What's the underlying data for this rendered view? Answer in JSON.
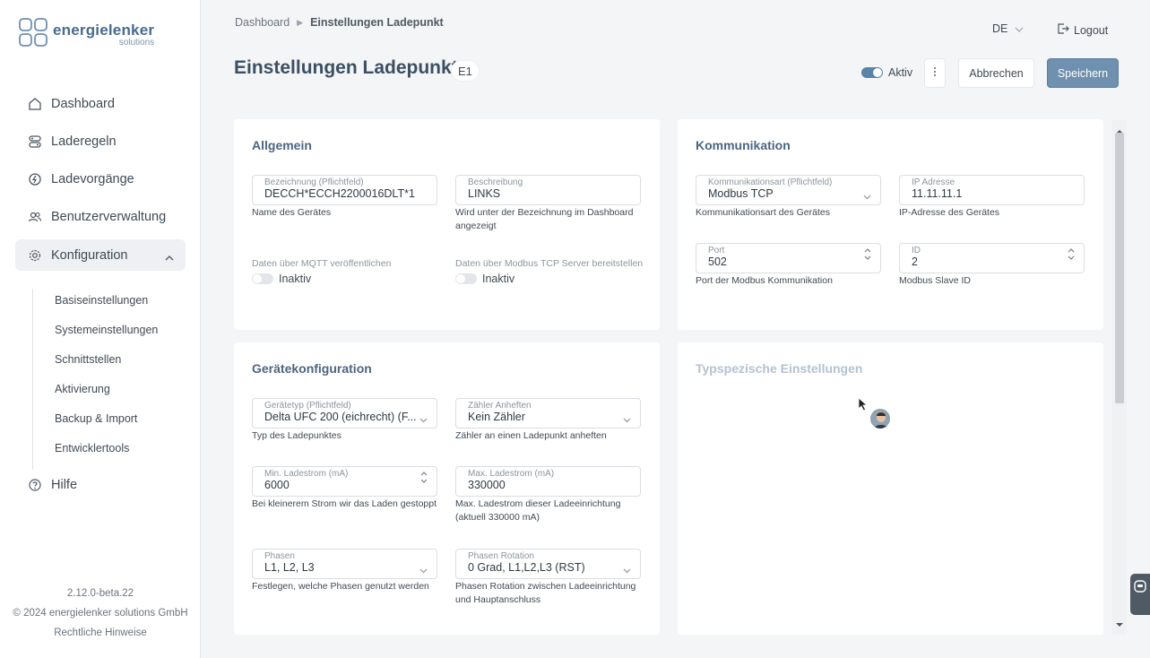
{
  "brand": {
    "name": "energielenker",
    "sub": "solutions"
  },
  "nav": {
    "items": [
      {
        "label": "Dashboard",
        "icon": "home-icon"
      },
      {
        "label": "Laderegeln",
        "icon": "rules-icon"
      },
      {
        "label": "Ladevorgänge",
        "icon": "charging-sessions-icon"
      },
      {
        "label": "Benutzerverwaltung",
        "icon": "users-icon"
      },
      {
        "label": "Konfiguration",
        "icon": "gear-icon"
      },
      {
        "label": "Hilfe",
        "icon": "help-icon"
      }
    ],
    "subitems": [
      "Basiseinstellungen",
      "Systemeinstellungen",
      "Schnittstellen",
      "Aktivierung",
      "Backup & Import",
      "Entwicklertools"
    ]
  },
  "footer": {
    "version": "2.12.0-beta.22",
    "copyright": "© 2024 energielenker solutions GmbH",
    "legal": "Rechtliche Hinweise"
  },
  "header": {
    "breadcrumb": [
      "Dashboard",
      "Einstellungen Ladepunkt"
    ],
    "language": "DE",
    "logout": "Logout",
    "title": "Einstellungen Ladepunkt",
    "badge": "E1",
    "active_label": "Aktiv",
    "cancel": "Abbrechen",
    "save": "Speichern"
  },
  "allgemein": {
    "title": "Allgemein",
    "name_label": "Bezeichnung (Pflichtfeld)",
    "name_value": "DECCH*ECCH2200016DLT*1",
    "name_hint": "Name des Gerätes",
    "desc_label": "Beschreibung",
    "desc_value": "LINKS",
    "desc_hint": "Wird unter der Bezeichnung im Dashboard angezeigt",
    "mqtt_label": "Daten über MQTT veröffentlichen",
    "mqtt_state": "Inaktiv",
    "modbus_label": "Daten über Modbus TCP Server bereitstellen",
    "modbus_state": "Inaktiv"
  },
  "kommunikation": {
    "title": "Kommunikation",
    "type_label": "Kommunikationsart (Pflichtfeld)",
    "type_value": "Modbus TCP",
    "type_hint": "Kommunikationsart des Gerätes",
    "ip_label": "IP Adresse",
    "ip_value": "11.11.11.1",
    "ip_hint": "IP-Adresse des Gerätes",
    "port_label": "Port",
    "port_value": "502",
    "port_hint": "Port der Modbus Kommunikation",
    "id_label": "ID",
    "id_value": "2",
    "id_hint": "Modbus Slave ID"
  },
  "geraet": {
    "title": "Gerätekonfiguration",
    "type_label": "Gerätetyp (Pflichtfeld)",
    "type_value": "Delta UFC 200 (eichrecht) (F...",
    "type_hint": "Typ des Ladepunktes",
    "meter_label": "Zähler Anheften",
    "meter_value": "Kein Zähler",
    "meter_hint": "Zähler an einen Ladepunkt anheften",
    "min_label": "Min. Ladestrom (mA)",
    "min_value": "6000",
    "min_hint": "Bei kleinerem Strom wir das Laden gestoppt",
    "max_label": "Max. Ladestrom (mA)",
    "max_value": "330000",
    "max_hint": "Max. Ladestrom dieser Ladeeinrichtung (aktuell 330000 mA)",
    "phases_label": "Phasen",
    "phases_value": "L1, L2, L3",
    "phases_hint": "Festlegen, welche Phasen genutzt werden",
    "rotation_label": "Phasen Rotation",
    "rotation_value": "0 Grad, L1,L2,L3 (RST)",
    "rotation_hint": "Phasen Rotation zwischen Ladeeinrichtung und Hauptanschluss"
  },
  "typ": {
    "title": "Typspezische Einstellungen"
  },
  "colors": {
    "accent": "#6f90ae",
    "title": "#3d4f63",
    "card_title": "#4c6580",
    "toggle_on": "#5b83a6"
  }
}
